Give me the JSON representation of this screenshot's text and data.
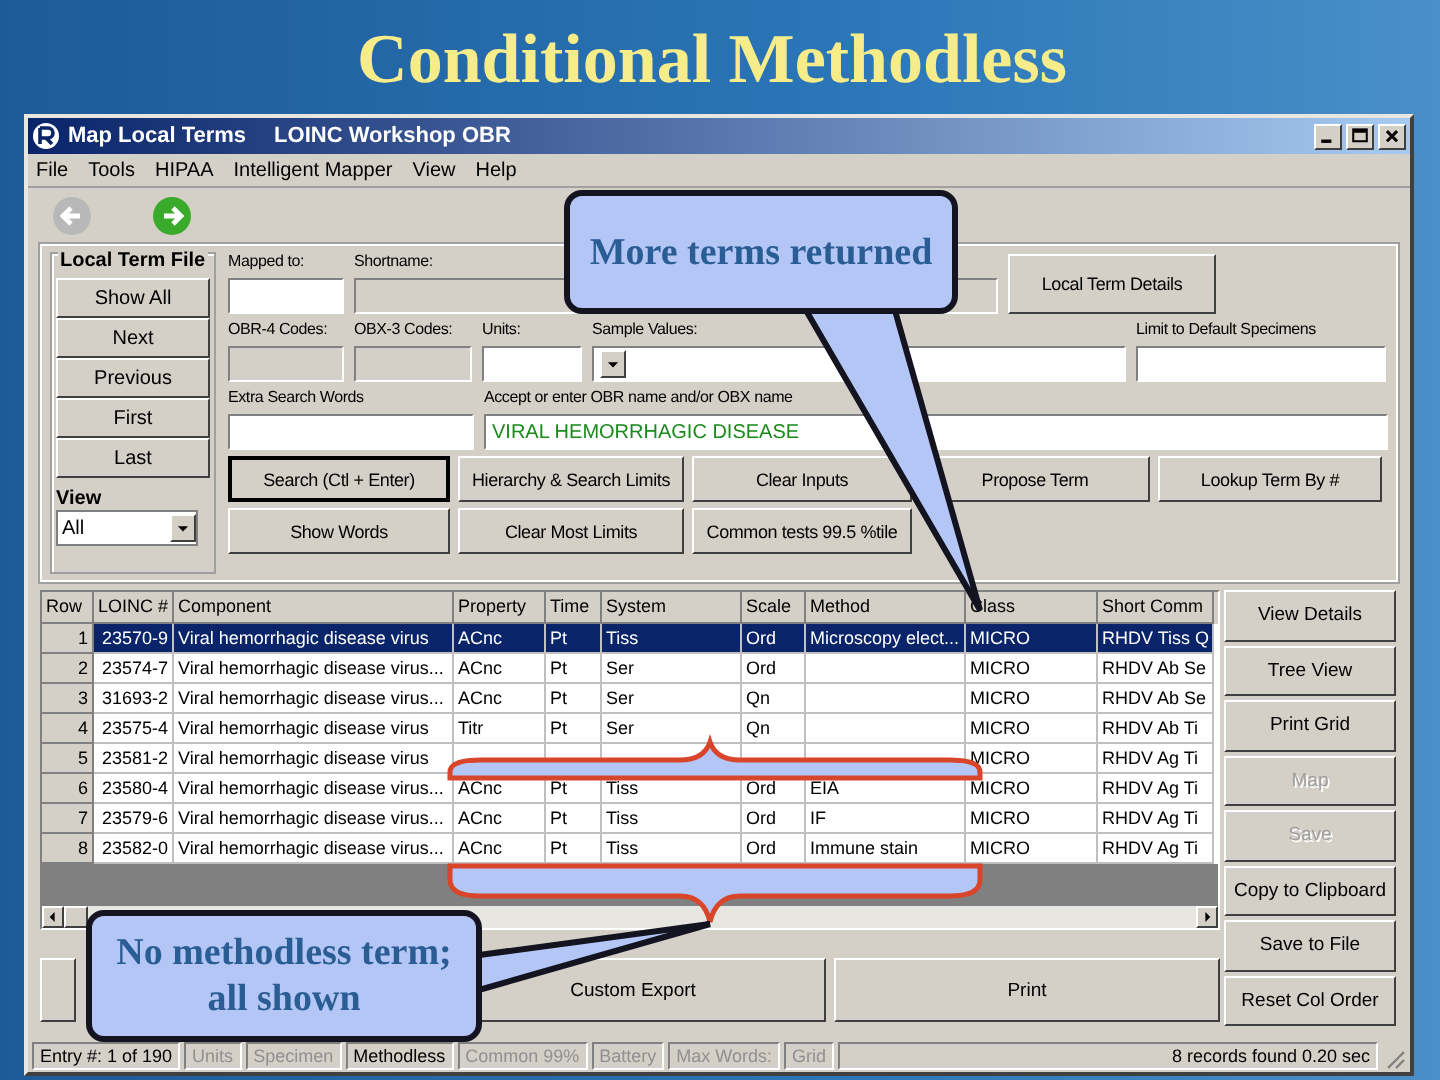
{
  "slide": {
    "title": "Conditional Methodless"
  },
  "window": {
    "title": "Map Local Terms",
    "subtitle": "LOINC Workshop OBR"
  },
  "menu": [
    "File",
    "Tools",
    "HIPAA",
    "Intelligent Mapper",
    "View",
    "Help"
  ],
  "local_term_file": {
    "title": "Local Term File",
    "buttons": [
      "Show All",
      "Next",
      "Previous",
      "First",
      "Last"
    ],
    "view_label": "View",
    "view_value": "All"
  },
  "field_rows": [
    [
      {
        "label": "Mapped to:",
        "kind": "input"
      },
      {
        "label": "Shortname:",
        "kind": "readonly"
      }
    ],
    [
      {
        "label": "OBR-4 Codes:",
        "kind": "readonly"
      },
      {
        "label": "OBX-3 Codes:",
        "kind": "readonly"
      },
      {
        "label": "Units:",
        "kind": "input"
      },
      {
        "label": "Sample Values:",
        "kind": "dropdown"
      },
      {
        "label": "Limit to Default Specimens",
        "kind": "input"
      }
    ],
    [
      {
        "label": "Extra Search Words",
        "kind": "input"
      },
      {
        "label": "Accept or enter OBR name and/or OBX name",
        "kind": "input",
        "value": "VIRAL HEMORRHAGIC DISEASE"
      }
    ]
  ],
  "details_button": "Local Term Details",
  "button_rows": [
    [
      {
        "label": "Search (Ctl + Enter)",
        "default": true
      },
      {
        "label": "Hierarchy & Search Limits",
        "default": false
      },
      {
        "label": "Clear Inputs",
        "default": false
      },
      {
        "label": "Propose Term",
        "default": false
      },
      {
        "label": "Lookup Term By #",
        "default": false
      }
    ],
    [
      {
        "label": "Show Words",
        "default": false
      },
      {
        "label": "Clear Most Limits",
        "default": false
      },
      {
        "label": "Common tests 99.5 %tile",
        "default": false
      }
    ]
  ],
  "grid": {
    "columns": [
      "Row",
      "LOINC #",
      "Component",
      "Property",
      "Time",
      "System",
      "Scale",
      "Method",
      "Class",
      "Short Comm"
    ],
    "rows": [
      {
        "selected": true,
        "row": "1",
        "loinc": "23570-9",
        "component": "Viral hemorrhagic disease virus",
        "property": "ACnc",
        "time": "Pt",
        "system": "Tiss",
        "scale": "Ord",
        "method": "Microscopy elect...",
        "class": "MICRO",
        "short": "RHDV Tiss Q"
      },
      {
        "selected": false,
        "row": "2",
        "loinc": "23574-7",
        "component": "Viral hemorrhagic disease virus...",
        "property": "ACnc",
        "time": "Pt",
        "system": "Ser",
        "scale": "Ord",
        "class": "MICRO",
        "short": "RHDV Ab Se"
      },
      {
        "selected": false,
        "row": "3",
        "loinc": "31693-2",
        "component": "Viral hemorrhagic disease virus...",
        "property": "ACnc",
        "time": "Pt",
        "system": "Ser",
        "scale": "Qn",
        "class": "MICRO",
        "short": "RHDV Ab Se"
      },
      {
        "selected": false,
        "row": "4",
        "loinc": "23575-4",
        "component": "Viral hemorrhagic disease virus",
        "property": "Titr",
        "time": "Pt",
        "system": "Ser",
        "scale": "Qn",
        "class": "MICRO",
        "short": "RHDV Ab Ti"
      },
      {
        "selected": false,
        "row": "5",
        "loinc": "23581-2",
        "component": "Viral hemorrhagic disease virus",
        "class": "MICRO",
        "short": "RHDV Ag Ti"
      },
      {
        "selected": false,
        "row": "6",
        "loinc": "23580-4",
        "component": "Viral hemorrhagic disease virus...",
        "property": "ACnc",
        "time": "Pt",
        "system": "Tiss",
        "scale": "Ord",
        "method": "EIA",
        "class": "MICRO",
        "short": "RHDV Ag Ti"
      },
      {
        "selected": false,
        "row": "7",
        "loinc": "23579-6",
        "component": "Viral hemorrhagic disease virus...",
        "property": "ACnc",
        "time": "Pt",
        "system": "Tiss",
        "scale": "Ord",
        "method": "IF",
        "class": "MICRO",
        "short": "RHDV Ag Ti"
      },
      {
        "selected": false,
        "row": "8",
        "loinc": "23582-0",
        "component": "Viral hemorrhagic disease virus...",
        "property": "ACnc",
        "time": "Pt",
        "system": "Tiss",
        "scale": "Ord",
        "method": "Immune stain",
        "class": "MICRO",
        "short": "RHDV Ag Ti"
      }
    ]
  },
  "side_buttons": [
    {
      "label": "View Details",
      "disabled": false
    },
    {
      "label": "Tree View",
      "disabled": false
    },
    {
      "label": "Print Grid",
      "disabled": false
    },
    {
      "label": "Map",
      "disabled": true
    },
    {
      "label": "Save",
      "disabled": true
    },
    {
      "label": "Copy to Clipboard",
      "disabled": false
    },
    {
      "label": "Save to File",
      "disabled": false
    },
    {
      "label": "Reset Col Order",
      "disabled": false
    }
  ],
  "bottom_buttons": [
    "Custom Export",
    "Print"
  ],
  "status_bar": {
    "entry": "Entry #: 1 of 190",
    "panels": [
      {
        "label": "Units",
        "active": false
      },
      {
        "label": "Specimen",
        "active": false
      },
      {
        "label": "Methodless",
        "active": true
      },
      {
        "label": "Common 99%",
        "active": false
      },
      {
        "label": "Battery",
        "active": false
      },
      {
        "label": "Max Words:",
        "active": false
      },
      {
        "label": "Grid",
        "active": false
      }
    ],
    "result": "8 records found  0.20 sec"
  },
  "callouts": [
    {
      "text": "More terms returned"
    },
    {
      "text": "No methodless term; all shown"
    }
  ]
}
